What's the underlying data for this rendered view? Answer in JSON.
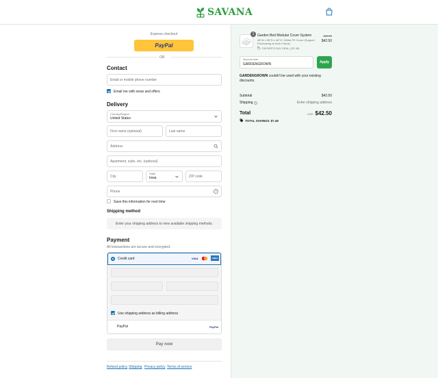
{
  "header": {
    "brand": "SAVANA",
    "logo_color": "#2f9e3f"
  },
  "express": {
    "title": "Express checkout",
    "paypal_label": "PayPal",
    "or": "OR"
  },
  "contact": {
    "title": "Contact",
    "email_placeholder": "Email or mobile phone number",
    "newsletter_label": "Email me with news and offers",
    "newsletter_checked": true
  },
  "delivery": {
    "title": "Delivery",
    "country_label": "Country/Region",
    "country_value": "United States",
    "first_name_placeholder": "First name (optional)",
    "last_name_placeholder": "Last name",
    "address_placeholder": "Address",
    "apartment_placeholder": "Apartment, suite, etc. (optional)",
    "city_placeholder": "City",
    "state_label": "State",
    "state_value": "Iowa",
    "zip_placeholder": "ZIP code",
    "phone_placeholder": "Phone",
    "save_info_label": "Save this information for next time",
    "save_info_checked": false
  },
  "shipping_method": {
    "title": "Shipping method",
    "message": "Enter your shipping address to view available shipping methods."
  },
  "payment": {
    "title": "Payment",
    "subtitle": "All transactions are secure and encrypted.",
    "credit_card_label": "Credit card",
    "card_brands": [
      "VISA",
      "MC",
      "AMEX"
    ],
    "billing_label": "Use shipping address as billing address",
    "billing_checked": true,
    "paypal_option_label": "PayPal",
    "paypal_option_badge": "PayPal",
    "pay_button": "Pay now"
  },
  "footer_links": [
    "Refund policy",
    "Shipping",
    "Privacy policy",
    "Terms of service"
  ],
  "summary": {
    "item": {
      "quantity": "1",
      "name": "Garden Bed Modular Cover System",
      "variant": "48\"W x 96\"D x 48\"H / White PE Cover (Support Purchasing w/ Arch Frame)",
      "discount_tag": "FATHER'S DAY DEAL (-$7.49)",
      "original_price": "$49.99",
      "price": "$42.50"
    },
    "discount_label": "Discount code",
    "discount_value": "GARDENGROWN",
    "apply_label": "Apply",
    "error_code": "GARDENGROWN",
    "error_text": " couldn't be used with your existing discounts.",
    "subtotal_label": "Subtotal",
    "subtotal_value": "$42.50",
    "shipping_label": "Shipping",
    "shipping_value": "Enter shipping address",
    "total_label": "Total",
    "currency": "USD",
    "total_value": "$42.50",
    "savings_label": "TOTAL SAVINGS",
    "savings_value": "$7.49"
  },
  "colors": {
    "accent_blue": "#1773b0",
    "apply_green": "#2ea44f",
    "paypal_yellow": "#ffc439",
    "summary_bg": "#f1f8f3"
  }
}
